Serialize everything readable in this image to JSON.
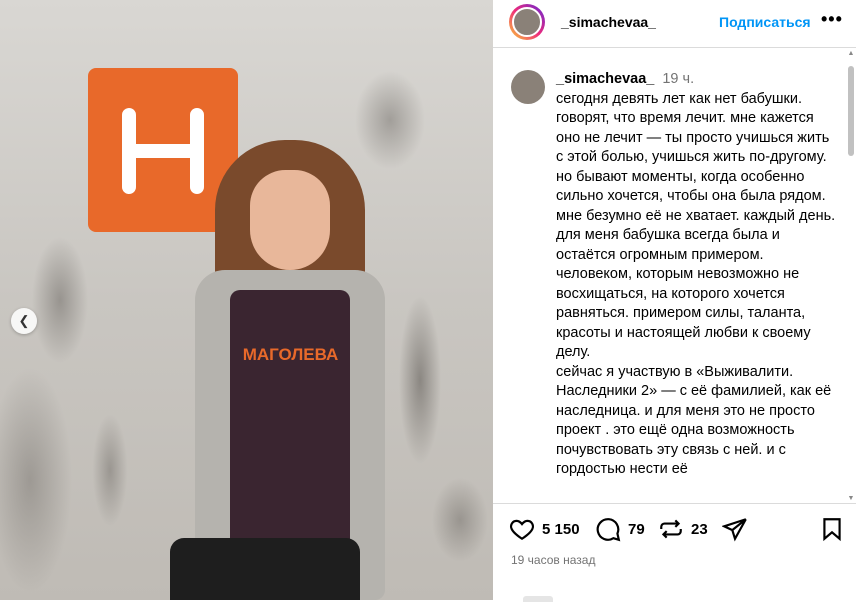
{
  "photo": {
    "logo_icon": "H-logo",
    "shirt_text": "МАГОЛЕВА",
    "carousel_prev_icon": "chevron-left-icon"
  },
  "header": {
    "username": "_simachevaa_",
    "subscribe_label": "Подписаться",
    "more_icon": "more-icon",
    "more_label": "•••"
  },
  "caption": {
    "username": "_simachevaa_",
    "time": "19 ч.",
    "text": "сегодня девять лет как нет бабушки. говорят, что время лечит. мне кажется оно не лечит — ты просто учишься жить с этой болью, учишься жить по-другому. но бывают моменты, когда особенно сильно хочется, чтобы она была рядом.",
    "text2": "мне безумно её не хватает. каждый день. для меня бабушка всегда была и остаётся огромным примером. человеком, которым невозможно не восхищаться, на которого хочется равняться. примером силы, таланта, красоты и настоящей любви к своему делу.",
    "text3": "сейчас я участвую в «Выживалити. Наследники 2» — с её фамилией, как её наследница. и для меня это не просто проект . это ещё одна возможность почувствовать эту связь с ней. и с гордостью нести её"
  },
  "actions": {
    "likes": "5 150",
    "comments": "79",
    "reposts": "23",
    "time_ago": "19 часов назад"
  },
  "colors": {
    "accent": "#0095f6",
    "logo_orange": "#e8692a"
  }
}
